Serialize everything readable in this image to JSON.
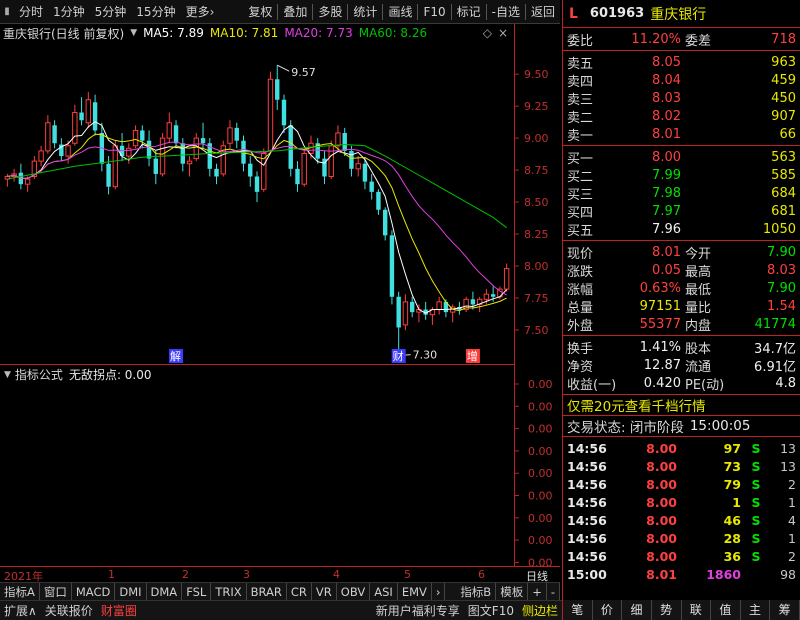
{
  "toolbar": {
    "left": [
      "分时",
      "1分钟",
      "5分钟",
      "15分钟",
      "更多"
    ],
    "more_arrow": "›",
    "right": [
      "复权",
      "叠加",
      "多股",
      "统计",
      "画线",
      "F10",
      "标记",
      "-自选",
      "返回"
    ]
  },
  "chart_header": {
    "name": "重庆银行(日线 前复权)",
    "ma5": "MA5: 7.89",
    "ma10": "MA10: 7.81",
    "ma20": "MA20: 7.73",
    "ma60": "MA60: 8.26",
    "ma_colors": {
      "ma5": "#ffffff",
      "ma10": "#e8e800",
      "ma20": "#e040e0",
      "ma60": "#00c000"
    }
  },
  "chart_data": {
    "type": "candlestick",
    "y_axis_ticks": [
      "9.50",
      "9.25",
      "9.00",
      "8.75",
      "8.50",
      "8.25",
      "8.00",
      "7.75",
      "7.50"
    ],
    "ylim": [
      7.25,
      9.72
    ],
    "high_label": "9.57",
    "low_label": "7.30",
    "event_markers": [
      "解",
      "财",
      "增"
    ],
    "x_ticks": [
      "2021年",
      "1",
      "2",
      "3",
      "4",
      "5",
      "6"
    ],
    "x_right_label": "日线",
    "candles": [
      [
        8.68,
        8.72,
        8.62,
        8.7
      ],
      [
        8.7,
        8.76,
        8.66,
        8.72
      ],
      [
        8.73,
        8.8,
        8.6,
        8.64
      ],
      [
        8.64,
        8.7,
        8.58,
        8.68
      ],
      [
        8.7,
        8.86,
        8.68,
        8.82
      ],
      [
        8.82,
        8.94,
        8.78,
        8.9
      ],
      [
        8.9,
        9.18,
        8.88,
        9.12
      ],
      [
        9.1,
        9.14,
        8.92,
        8.96
      ],
      [
        8.95,
        9.0,
        8.82,
        8.86
      ],
      [
        8.86,
        8.98,
        8.8,
        8.94
      ],
      [
        8.96,
        9.26,
        8.94,
        9.2
      ],
      [
        9.2,
        9.32,
        9.1,
        9.14
      ],
      [
        9.12,
        9.36,
        9.08,
        9.3
      ],
      [
        9.28,
        9.34,
        9.02,
        9.06
      ],
      [
        9.04,
        9.12,
        8.74,
        8.8
      ],
      [
        8.8,
        8.86,
        8.56,
        8.62
      ],
      [
        8.62,
        8.98,
        8.6,
        8.94
      ],
      [
        8.94,
        9.04,
        8.82,
        8.86
      ],
      [
        8.86,
        8.96,
        8.8,
        8.92
      ],
      [
        8.94,
        9.1,
        8.92,
        9.06
      ],
      [
        9.06,
        9.1,
        8.92,
        8.98
      ],
      [
        8.98,
        9.06,
        8.78,
        8.84
      ],
      [
        8.84,
        8.9,
        8.64,
        8.72
      ],
      [
        8.72,
        9.04,
        8.7,
        9.0
      ],
      [
        9.0,
        9.2,
        8.96,
        9.12
      ],
      [
        9.1,
        9.14,
        8.92,
        8.96
      ],
      [
        8.96,
        9.0,
        8.74,
        8.8
      ],
      [
        8.8,
        8.86,
        8.7,
        8.82
      ],
      [
        8.84,
        9.04,
        8.82,
        9.0
      ],
      [
        9.0,
        9.12,
        8.92,
        8.96
      ],
      [
        8.96,
        9.0,
        8.7,
        8.76
      ],
      [
        8.76,
        8.8,
        8.64,
        8.7
      ],
      [
        8.72,
        8.98,
        8.7,
        8.94
      ],
      [
        8.96,
        9.14,
        8.92,
        9.08
      ],
      [
        9.08,
        9.12,
        8.92,
        8.98
      ],
      [
        8.98,
        9.02,
        8.74,
        8.8
      ],
      [
        8.8,
        8.86,
        8.62,
        8.7
      ],
      [
        8.7,
        8.74,
        8.5,
        8.58
      ],
      [
        8.6,
        8.92,
        8.58,
        8.88
      ],
      [
        8.9,
        9.52,
        8.88,
        9.46
      ],
      [
        9.46,
        9.57,
        9.22,
        9.3
      ],
      [
        9.3,
        9.34,
        9.04,
        9.1
      ],
      [
        9.1,
        9.14,
        8.7,
        8.76
      ],
      [
        8.76,
        8.82,
        8.58,
        8.64
      ],
      [
        8.64,
        8.92,
        8.62,
        8.88
      ],
      [
        8.88,
        9.02,
        8.84,
        8.96
      ],
      [
        8.96,
        9.0,
        8.8,
        8.84
      ],
      [
        8.84,
        8.9,
        8.64,
        8.7
      ],
      [
        8.7,
        8.98,
        8.68,
        8.94
      ],
      [
        8.94,
        9.1,
        8.9,
        9.04
      ],
      [
        9.04,
        9.08,
        8.86,
        8.9
      ],
      [
        8.9,
        8.94,
        8.7,
        8.76
      ],
      [
        8.76,
        8.86,
        8.7,
        8.8
      ],
      [
        8.8,
        8.84,
        8.6,
        8.66
      ],
      [
        8.66,
        8.72,
        8.52,
        8.58
      ],
      [
        8.58,
        8.6,
        8.4,
        8.44
      ],
      [
        8.44,
        8.46,
        8.2,
        8.24
      ],
      [
        8.24,
        8.28,
        7.7,
        7.76
      ],
      [
        7.76,
        7.8,
        7.3,
        7.52
      ],
      [
        7.54,
        7.78,
        7.5,
        7.72
      ],
      [
        7.72,
        7.76,
        7.6,
        7.64
      ],
      [
        7.64,
        7.7,
        7.56,
        7.66
      ],
      [
        7.66,
        7.72,
        7.58,
        7.62
      ],
      [
        7.62,
        7.68,
        7.54,
        7.66
      ],
      [
        7.66,
        7.76,
        7.62,
        7.72
      ],
      [
        7.72,
        7.74,
        7.6,
        7.64
      ],
      [
        7.64,
        7.7,
        7.56,
        7.68
      ],
      [
        7.68,
        7.72,
        7.62,
        7.66
      ],
      [
        7.66,
        7.76,
        7.64,
        7.74
      ],
      [
        7.74,
        7.8,
        7.66,
        7.7
      ],
      [
        7.7,
        7.76,
        7.64,
        7.74
      ],
      [
        7.74,
        7.82,
        7.7,
        7.78
      ],
      [
        7.78,
        7.84,
        7.72,
        7.76
      ],
      [
        7.76,
        7.84,
        7.74,
        7.82
      ],
      [
        7.82,
        8.02,
        7.8,
        7.98
      ]
    ],
    "ma60_points": [
      [
        0,
        8.68
      ],
      [
        10,
        8.78
      ],
      [
        20,
        8.85
      ],
      [
        30,
        8.88
      ],
      [
        40,
        8.9
      ],
      [
        45,
        8.93
      ],
      [
        50,
        8.95
      ],
      [
        53,
        8.94
      ],
      [
        56,
        8.86
      ],
      [
        60,
        8.74
      ],
      [
        64,
        8.62
      ],
      [
        68,
        8.5
      ],
      [
        72,
        8.38
      ],
      [
        74,
        8.3
      ]
    ]
  },
  "indicator": {
    "title": "指标公式",
    "value": "无敌拐点: 0.00",
    "axis_ticks": [
      "0.00",
      "0.00",
      "0.00",
      "0.00",
      "0.00",
      "0.00",
      "0.00",
      "0.00",
      "0.00"
    ]
  },
  "bottom_tabs": [
    "指标A",
    "窗口",
    "MACD",
    "DMI",
    "DMA",
    "FSL",
    "TRIX",
    "BRAR",
    "CR",
    "VR",
    "OBV",
    "ASI",
    "EMV"
  ],
  "bottom_tabs_right": [
    "指标B",
    "模板",
    "+",
    "-"
  ],
  "bottom_bar": {
    "left": [
      "扩展∧",
      "关联报价",
      "财富圈"
    ],
    "right": [
      "新用户福利专享",
      "图文F10",
      "侧边栏"
    ]
  },
  "quote": {
    "logo": "L",
    "code": "601963",
    "name": "重庆银行",
    "weibi_label": "委比",
    "weibi": "11.20%",
    "weicha_label": "委差",
    "weicha": "718",
    "asks": [
      {
        "label": "卖五",
        "price": "8.05",
        "vol": "963"
      },
      {
        "label": "卖四",
        "price": "8.04",
        "vol": "459"
      },
      {
        "label": "卖三",
        "price": "8.03",
        "vol": "450"
      },
      {
        "label": "卖二",
        "price": "8.02",
        "vol": "907"
      },
      {
        "label": "卖一",
        "price": "8.01",
        "vol": "66"
      }
    ],
    "bids": [
      {
        "label": "买一",
        "price": "8.00",
        "vol": "563"
      },
      {
        "label": "买二",
        "price": "7.99",
        "vol": "585"
      },
      {
        "label": "买三",
        "price": "7.98",
        "vol": "684"
      },
      {
        "label": "买四",
        "price": "7.97",
        "vol": "681"
      },
      {
        "label": "买五",
        "price": "7.96",
        "vol": "1050"
      }
    ],
    "stats": [
      {
        "l1": "现价",
        "v1": "8.01",
        "c1": "red",
        "l2": "今开",
        "v2": "7.90",
        "c2": "grn"
      },
      {
        "l1": "涨跌",
        "v1": "0.05",
        "c1": "red",
        "l2": "最高",
        "v2": "8.03",
        "c2": "red"
      },
      {
        "l1": "涨幅",
        "v1": "0.63%",
        "c1": "red",
        "l2": "最低",
        "v2": "7.90",
        "c2": "grn"
      },
      {
        "l1": "总量",
        "v1": "97151",
        "c1": "yel",
        "l2": "量比",
        "v2": "1.54",
        "c2": "red"
      },
      {
        "l1": "外盘",
        "v1": "55377",
        "c1": "red",
        "l2": "内盘",
        "v2": "41774",
        "c2": "grn"
      }
    ],
    "fin": [
      {
        "l1": "换手",
        "v1": "1.41%",
        "l2": "股本",
        "v2": "34.7亿"
      },
      {
        "l1": "净资",
        "v1": "12.87",
        "l2": "流通",
        "v2": "6.91亿"
      },
      {
        "l1": "收益(一)",
        "v1": "0.420",
        "l2": "PE(动)",
        "v2": "4.8"
      }
    ],
    "promo": "仅需20元查看千档行情",
    "status_label": "交易状态: 闭市阶段",
    "status_time": "15:00:05",
    "ticks": [
      {
        "t": "14:56",
        "p": "8.00",
        "v": "97",
        "s": "S",
        "n": "13"
      },
      {
        "t": "14:56",
        "p": "8.00",
        "v": "73",
        "s": "S",
        "n": "13"
      },
      {
        "t": "14:56",
        "p": "8.00",
        "v": "79",
        "s": "S",
        "n": "2"
      },
      {
        "t": "14:56",
        "p": "8.00",
        "v": "1",
        "s": "S",
        "n": "1"
      },
      {
        "t": "14:56",
        "p": "8.00",
        "v": "46",
        "s": "S",
        "n": "4"
      },
      {
        "t": "14:56",
        "p": "8.00",
        "v": "28",
        "s": "S",
        "n": "1"
      },
      {
        "t": "14:56",
        "p": "8.00",
        "v": "36",
        "s": "S",
        "n": "2"
      },
      {
        "t": "15:00",
        "p": "8.01",
        "v": "1860",
        "s": "",
        "n": "98"
      }
    ]
  },
  "right_buttons": [
    "笔",
    "价",
    "细",
    "势",
    "联",
    "值",
    "主",
    "筹"
  ]
}
